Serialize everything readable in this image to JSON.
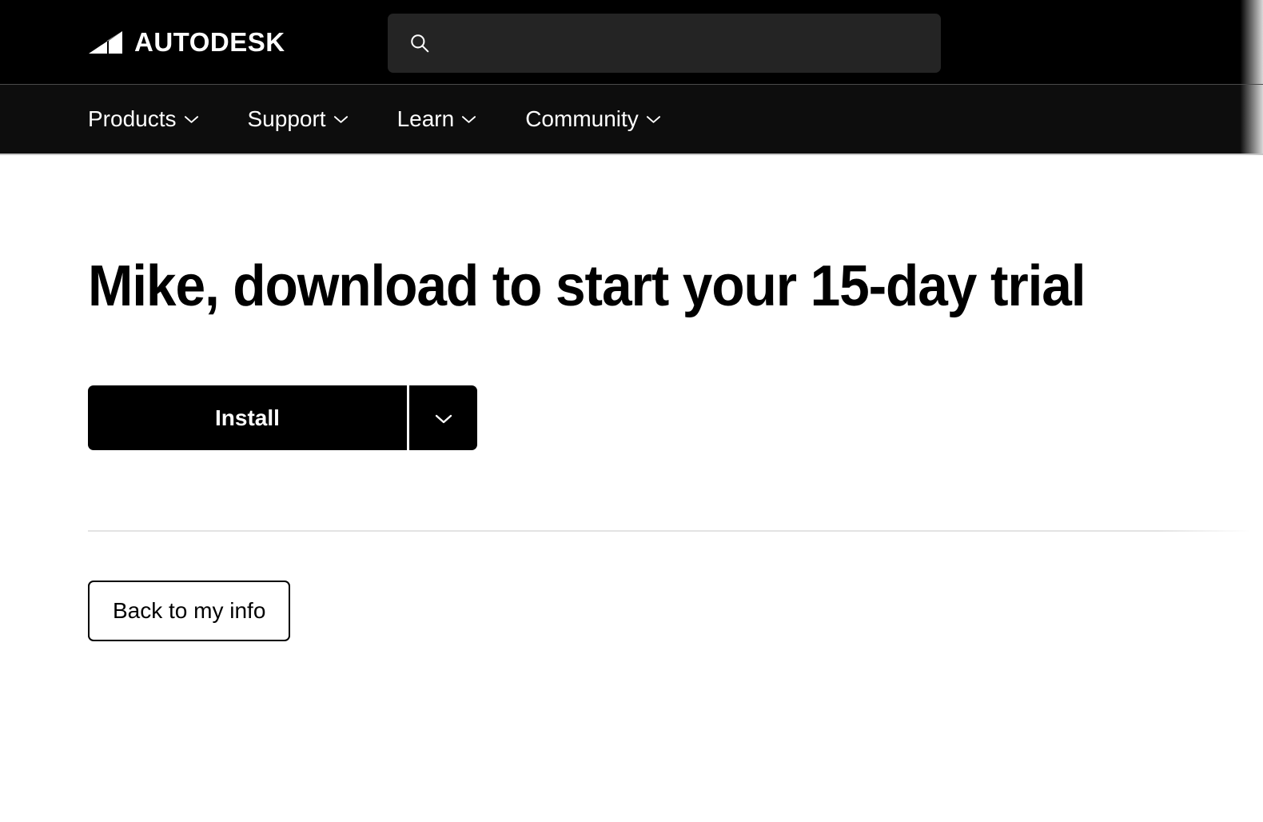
{
  "header": {
    "logo": {
      "mark_icon": "autodesk-mark-icon",
      "wordmark": "AUTODESK"
    },
    "search": {
      "icon": "search-icon",
      "value": "",
      "placeholder": ""
    }
  },
  "nav": {
    "items": [
      {
        "label": "Products",
        "icon": "chevron-down-icon"
      },
      {
        "label": "Support",
        "icon": "chevron-down-icon"
      },
      {
        "label": "Learn",
        "icon": "chevron-down-icon"
      },
      {
        "label": "Community",
        "icon": "chevron-down-icon"
      }
    ]
  },
  "main": {
    "title": "Mike, download to start your 15-day trial",
    "install_button": {
      "label": "Install",
      "dropdown_icon": "chevron-down-icon"
    },
    "back_button": {
      "label": "Back to my info"
    }
  },
  "colors": {
    "header_background": "#000000",
    "nav_background": "#0d0d0d",
    "page_background": "#ffffff",
    "search_field": "#242424",
    "primary_button": "#000000",
    "primary_button_text": "#ffffff",
    "text": "#000000",
    "divider": "#e3e3e3"
  }
}
